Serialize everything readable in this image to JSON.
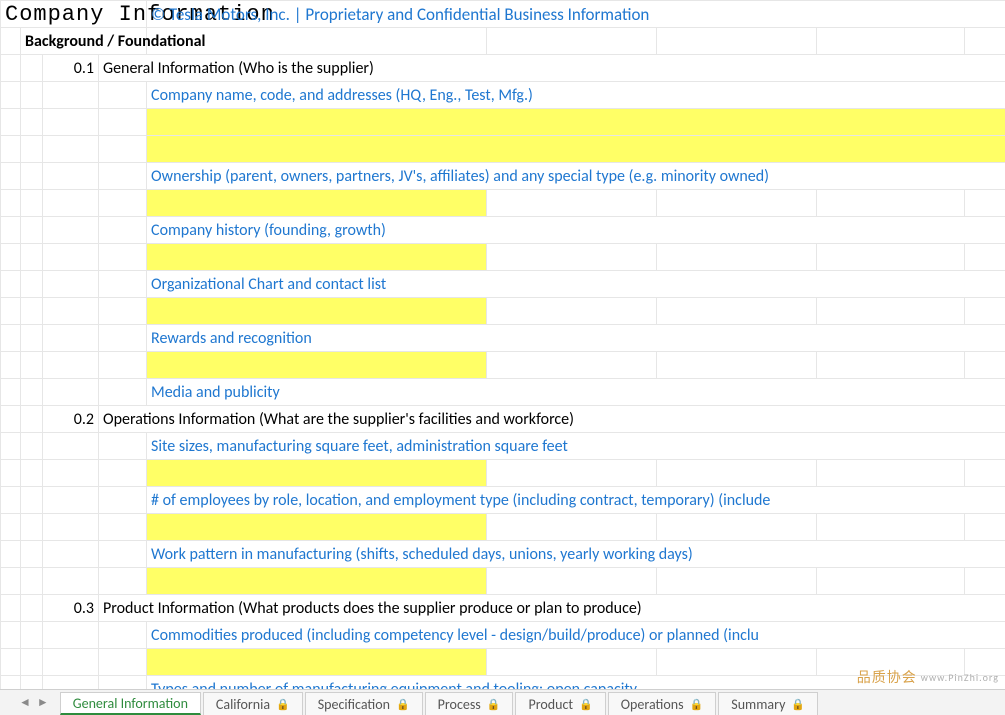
{
  "header": {
    "title": "Company Information",
    "copyright": "© Tesla Motors, Inc. | Proprietary and Confidential Business Information"
  },
  "section_header": "Background / Foundational",
  "sections": [
    {
      "num": "0.1",
      "title": "General Information (Who is the supplier)",
      "items": [
        {
          "text": "Company name, code, and addresses (HQ, Eng., Test, Mfg.)",
          "yellow_rows": 2,
          "yellow_span": 5
        },
        {
          "text": "Ownership (parent, owners, partners, JV's, affiliates) and any special type (e.g. minority owned)",
          "yellow_rows": 1,
          "yellow_span": 1
        },
        {
          "text": "Company history (founding, growth)",
          "yellow_rows": 1,
          "yellow_span": 1
        },
        {
          "text": "Organizational Chart and contact list",
          "yellow_rows": 1,
          "yellow_span": 1
        },
        {
          "text": "Rewards and recognition",
          "yellow_rows": 1,
          "yellow_span": 1
        },
        {
          "text": "Media and publicity",
          "yellow_rows": 0
        }
      ]
    },
    {
      "num": "0.2",
      "title": "Operations Information (What are the supplier's facilities and workforce)",
      "items": [
        {
          "text": "Site sizes, manufacturing square feet, administration square feet",
          "yellow_rows": 1,
          "yellow_span": 1
        },
        {
          "text": "# of employees by role, location, and employment type (including contract, temporary) (include",
          "yellow_rows": 1,
          "yellow_span": 1
        },
        {
          "text": "Work pattern in manufacturing (shifts, scheduled days, unions, yearly working days)",
          "yellow_rows": 1,
          "yellow_span": 1
        }
      ]
    },
    {
      "num": "0.3",
      "title": "Product Information (What products does the supplier produce or plan to produce)",
      "items": [
        {
          "text": "Commodities produced (including competency level - design/build/produce) or planned (inclu",
          "yellow_rows": 1,
          "yellow_span": 1
        },
        {
          "text": "Types and number of manufacturing equipment and tooling; open capacity",
          "yellow_rows": 0,
          "cutoff": true
        }
      ]
    }
  ],
  "tabs": [
    {
      "label": "General Information",
      "active": true
    },
    {
      "label": "California",
      "locked": true
    },
    {
      "label": "Specification",
      "locked": true
    },
    {
      "label": "Process",
      "locked": true
    },
    {
      "label": "Product",
      "locked": true
    },
    {
      "label": "Operations",
      "locked": true
    },
    {
      "label": "Summary",
      "locked": true
    }
  ],
  "watermark": {
    "chars": "品质协会",
    "url": "www.PinZhi.org"
  }
}
